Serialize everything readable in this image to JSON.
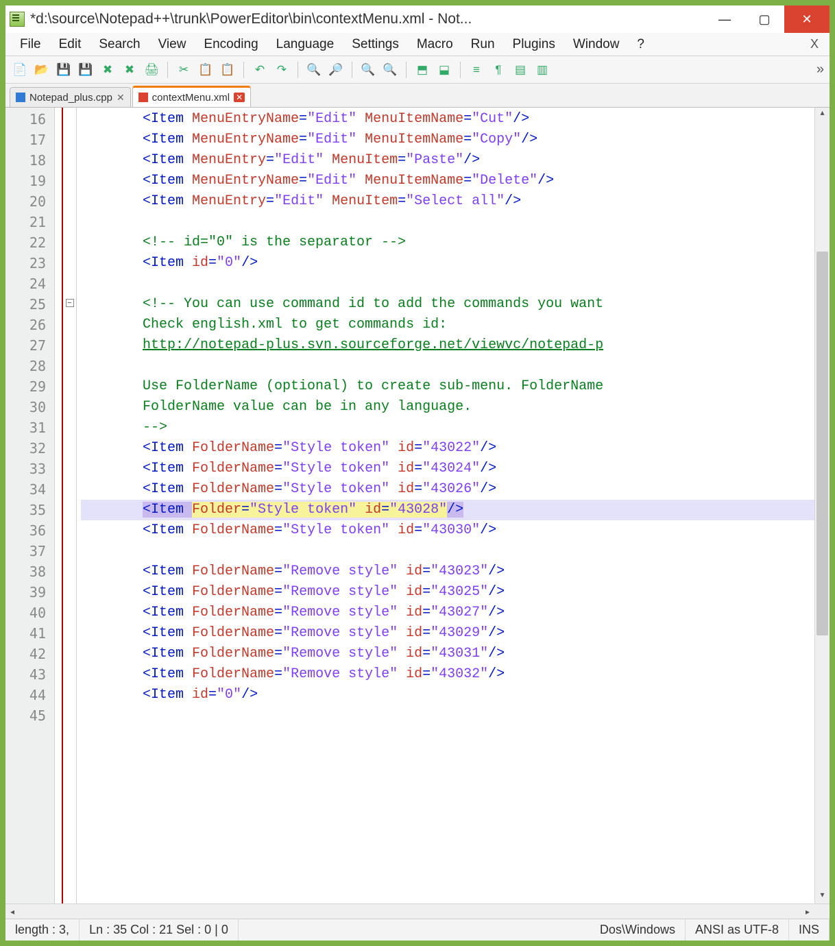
{
  "window": {
    "title": "*d:\\source\\Notepad++\\trunk\\PowerEditor\\bin\\contextMenu.xml - Not..."
  },
  "menubar": [
    "File",
    "Edit",
    "Search",
    "View",
    "Encoding",
    "Language",
    "Settings",
    "Macro",
    "Run",
    "Plugins",
    "Window",
    "?"
  ],
  "tabs": [
    {
      "label": "Notepad_plus.cpp",
      "active": false,
      "icon": "blue"
    },
    {
      "label": "contextMenu.xml",
      "active": true,
      "icon": "red"
    }
  ],
  "toolbar_buttons": [
    "new-file",
    "open-file",
    "save",
    "save-all",
    "close-file",
    "close-all",
    "print",
    "|",
    "cut",
    "copy",
    "paste",
    "|",
    "undo",
    "redo",
    "|",
    "find",
    "replace",
    "|",
    "zoom-in",
    "zoom-out",
    "|",
    "sync-v",
    "sync-h",
    "|",
    "word-wrap",
    "show-all",
    "toggle-1",
    "toggle-2"
  ],
  "code_lines": [
    {
      "n": 16,
      "seg": [
        [
          "t-tag",
          "<Item "
        ],
        [
          "t-attr",
          "MenuEntryName"
        ],
        [
          "t-tag",
          "="
        ],
        [
          "t-str",
          "\"Edit\""
        ],
        [
          "",
          ""
        ],
        [
          "t-attr",
          " MenuItemName"
        ],
        [
          "t-tag",
          "="
        ],
        [
          "t-str",
          "\"Cut\""
        ],
        [
          "t-tag",
          "/>"
        ]
      ]
    },
    {
      "n": 17,
      "seg": [
        [
          "t-tag",
          "<Item "
        ],
        [
          "t-attr",
          "MenuEntryName"
        ],
        [
          "t-tag",
          "="
        ],
        [
          "t-str",
          "\"Edit\""
        ],
        [
          "t-attr",
          " MenuItemName"
        ],
        [
          "t-tag",
          "="
        ],
        [
          "t-str",
          "\"Copy\""
        ],
        [
          "t-tag",
          "/>"
        ]
      ]
    },
    {
      "n": 18,
      "seg": [
        [
          "t-tag",
          "<Item "
        ],
        [
          "t-attr",
          "MenuEntry"
        ],
        [
          "t-tag",
          "="
        ],
        [
          "t-str",
          "\"Edit\""
        ],
        [
          "t-attr",
          " MenuItem"
        ],
        [
          "t-tag",
          "="
        ],
        [
          "t-str",
          "\"Paste\""
        ],
        [
          "t-tag",
          "/>"
        ]
      ]
    },
    {
      "n": 19,
      "seg": [
        [
          "t-tag",
          "<Item "
        ],
        [
          "t-attr",
          "MenuEntryName"
        ],
        [
          "t-tag",
          "="
        ],
        [
          "t-str",
          "\"Edit\""
        ],
        [
          "t-attr",
          " MenuItemName"
        ],
        [
          "t-tag",
          "="
        ],
        [
          "t-str",
          "\"Delete\""
        ],
        [
          "t-tag",
          "/>"
        ]
      ]
    },
    {
      "n": 20,
      "seg": [
        [
          "t-tag",
          "<Item "
        ],
        [
          "t-attr",
          "MenuEntry"
        ],
        [
          "t-tag",
          "="
        ],
        [
          "t-str",
          "\"Edit\""
        ],
        [
          "t-attr",
          " MenuItem"
        ],
        [
          "t-tag",
          "="
        ],
        [
          "t-str",
          "\"Select all\""
        ],
        [
          "t-tag",
          "/>"
        ]
      ]
    },
    {
      "n": 21,
      "seg": []
    },
    {
      "n": 22,
      "seg": [
        [
          "t-cmt",
          "<!-- id=\"0\" is the separator -->"
        ]
      ]
    },
    {
      "n": 23,
      "seg": [
        [
          "t-tag",
          "<Item "
        ],
        [
          "t-attr",
          "id"
        ],
        [
          "t-tag",
          "="
        ],
        [
          "t-str",
          "\"0\""
        ],
        [
          "t-tag",
          "/>"
        ]
      ]
    },
    {
      "n": 24,
      "seg": []
    },
    {
      "n": 25,
      "fold": true,
      "seg": [
        [
          "t-cmt",
          "<!-- You can use command id to add the commands you want"
        ]
      ]
    },
    {
      "n": 26,
      "seg": [
        [
          "t-cmt",
          "Check english.xml to get commands id:"
        ]
      ]
    },
    {
      "n": 27,
      "seg": [
        [
          "t-url",
          "http://notepad-plus.svn.sourceforge.net/viewvc/notepad-p"
        ]
      ]
    },
    {
      "n": 28,
      "seg": []
    },
    {
      "n": 29,
      "seg": [
        [
          "t-cmt",
          "Use FolderName (optional) to create sub-menu. FolderName"
        ]
      ]
    },
    {
      "n": 30,
      "seg": [
        [
          "t-cmt",
          "FolderName value can be in any language."
        ]
      ]
    },
    {
      "n": 31,
      "seg": [
        [
          "t-cmt",
          "-->"
        ]
      ]
    },
    {
      "n": 32,
      "seg": [
        [
          "t-tag",
          "<Item "
        ],
        [
          "t-attr",
          "FolderName"
        ],
        [
          "t-tag",
          "="
        ],
        [
          "t-str",
          "\"Style token\""
        ],
        [
          "t-attr",
          " id"
        ],
        [
          "t-tag",
          "="
        ],
        [
          "t-str",
          "\"43022\""
        ],
        [
          "t-tag",
          "/>"
        ]
      ]
    },
    {
      "n": 33,
      "seg": [
        [
          "t-tag",
          "<Item "
        ],
        [
          "t-attr",
          "FolderName"
        ],
        [
          "t-tag",
          "="
        ],
        [
          "t-str",
          "\"Style token\""
        ],
        [
          "t-attr",
          " id"
        ],
        [
          "t-tag",
          "="
        ],
        [
          "t-str",
          "\"43024\""
        ],
        [
          "t-tag",
          "/>"
        ]
      ]
    },
    {
      "n": 34,
      "seg": [
        [
          "t-tag",
          "<Item "
        ],
        [
          "t-attr",
          "FolderName"
        ],
        [
          "t-tag",
          "="
        ],
        [
          "t-str",
          "\"Style token\""
        ],
        [
          "t-attr",
          " id"
        ],
        [
          "t-tag",
          "="
        ],
        [
          "t-str",
          "\"43026\""
        ],
        [
          "t-tag",
          "/>"
        ]
      ]
    },
    {
      "n": 35,
      "hl": true,
      "seg": [
        [
          "t-tag smart-a",
          "<Item "
        ],
        [
          "t-attr smart-b",
          "Folder"
        ],
        [
          "t-tag smart-b",
          "="
        ],
        [
          "t-str smart-b",
          "\"Style token\""
        ],
        [
          "t-attr smart-b",
          " id"
        ],
        [
          "t-tag smart-b",
          "="
        ],
        [
          "t-str smart-b",
          "\"43028\""
        ],
        [
          "t-tag smart-a",
          "/>"
        ]
      ]
    },
    {
      "n": 36,
      "seg": [
        [
          "t-tag",
          "<Item "
        ],
        [
          "t-attr",
          "FolderName"
        ],
        [
          "t-tag",
          "="
        ],
        [
          "t-str",
          "\"Style token\""
        ],
        [
          "t-attr",
          " id"
        ],
        [
          "t-tag",
          "="
        ],
        [
          "t-str",
          "\"43030\""
        ],
        [
          "t-tag",
          "/>"
        ]
      ]
    },
    {
      "n": 37,
      "seg": []
    },
    {
      "n": 38,
      "seg": [
        [
          "t-tag",
          "<Item "
        ],
        [
          "t-attr",
          "FolderName"
        ],
        [
          "t-tag",
          "="
        ],
        [
          "t-str",
          "\"Remove style\""
        ],
        [
          "t-attr",
          " id"
        ],
        [
          "t-tag",
          "="
        ],
        [
          "t-str",
          "\"43023\""
        ],
        [
          "t-tag",
          "/>"
        ]
      ]
    },
    {
      "n": 39,
      "seg": [
        [
          "t-tag",
          "<Item "
        ],
        [
          "t-attr",
          "FolderName"
        ],
        [
          "t-tag",
          "="
        ],
        [
          "t-str",
          "\"Remove style\""
        ],
        [
          "t-attr",
          " id"
        ],
        [
          "t-tag",
          "="
        ],
        [
          "t-str",
          "\"43025\""
        ],
        [
          "t-tag",
          "/>"
        ]
      ]
    },
    {
      "n": 40,
      "seg": [
        [
          "t-tag",
          "<Item "
        ],
        [
          "t-attr",
          "FolderName"
        ],
        [
          "t-tag",
          "="
        ],
        [
          "t-str",
          "\"Remove style\""
        ],
        [
          "t-attr",
          " id"
        ],
        [
          "t-tag",
          "="
        ],
        [
          "t-str",
          "\"43027\""
        ],
        [
          "t-tag",
          "/>"
        ]
      ]
    },
    {
      "n": 41,
      "seg": [
        [
          "t-tag",
          "<Item "
        ],
        [
          "t-attr",
          "FolderName"
        ],
        [
          "t-tag",
          "="
        ],
        [
          "t-str",
          "\"Remove style\""
        ],
        [
          "t-attr",
          " id"
        ],
        [
          "t-tag",
          "="
        ],
        [
          "t-str",
          "\"43029\""
        ],
        [
          "t-tag",
          "/>"
        ]
      ]
    },
    {
      "n": 42,
      "seg": [
        [
          "t-tag",
          "<Item "
        ],
        [
          "t-attr",
          "FolderName"
        ],
        [
          "t-tag",
          "="
        ],
        [
          "t-str",
          "\"Remove style\""
        ],
        [
          "t-attr",
          " id"
        ],
        [
          "t-tag",
          "="
        ],
        [
          "t-str",
          "\"43031\""
        ],
        [
          "t-tag",
          "/>"
        ]
      ]
    },
    {
      "n": 43,
      "seg": [
        [
          "t-tag",
          "<Item "
        ],
        [
          "t-attr",
          "FolderName"
        ],
        [
          "t-tag",
          "="
        ],
        [
          "t-str",
          "\"Remove style\""
        ],
        [
          "t-attr",
          " id"
        ],
        [
          "t-tag",
          "="
        ],
        [
          "t-str",
          "\"43032\""
        ],
        [
          "t-tag",
          "/>"
        ]
      ]
    },
    {
      "n": 44,
      "seg": [
        [
          "t-tag",
          "<Item "
        ],
        [
          "t-attr",
          "id"
        ],
        [
          "t-tag",
          "="
        ],
        [
          "t-str",
          "\"0\""
        ],
        [
          "t-tag",
          "/>"
        ]
      ]
    },
    {
      "n": 45,
      "seg": []
    }
  ],
  "status": {
    "length": "length : 3,",
    "pos": "Ln : 35    Col : 21    Sel : 0 | 0",
    "eol": "Dos\\Windows",
    "enc": "ANSI as UTF-8",
    "mode": "INS"
  }
}
